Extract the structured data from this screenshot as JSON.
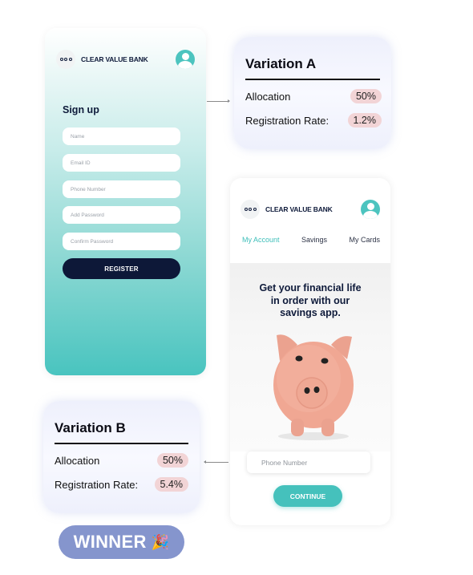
{
  "colors": {
    "brand_navy": "#0d1838",
    "teal_accent": "#45c1bc",
    "pill_pink": "#f2d4d6",
    "winner_badge": "#8595cd"
  },
  "signup_screen": {
    "brand": "CLEAR VALUE BANK",
    "menu_icon": "more-dots-icon",
    "avatar_icon": "user-avatar-icon",
    "title": "Sign up",
    "fields": [
      {
        "placeholder": "Name"
      },
      {
        "placeholder": "Email ID"
      },
      {
        "placeholder": "Phone Number"
      },
      {
        "placeholder": "Add Password"
      },
      {
        "placeholder": "Confirm Password"
      }
    ],
    "register_label": "REGISTER"
  },
  "variation_a": {
    "title": "Variation A",
    "rows": [
      {
        "label": "Allocation",
        "value": "50%"
      },
      {
        "label": "Registration Rate:",
        "value": "1.2%"
      }
    ]
  },
  "variation_b": {
    "title": "Variation B",
    "rows": [
      {
        "label": "Allocation",
        "value": "50%"
      },
      {
        "label": "Registration Rate:",
        "value": "5.4%"
      }
    ]
  },
  "savings_screen": {
    "brand": "CLEAR VALUE BANK",
    "tabs": [
      {
        "label": "My Account",
        "active": true
      },
      {
        "label": "Savings",
        "active": false
      },
      {
        "label": "My Cards",
        "active": false
      }
    ],
    "hero_lines": [
      "Get your financial life",
      "in order with our",
      "savings app."
    ],
    "hero_image": "piggy-bank-image",
    "phone_placeholder": "Phone Number",
    "continue_label": "CONTINUE"
  },
  "winner_badge": {
    "label": "WINNER",
    "emoji": "🎉"
  }
}
